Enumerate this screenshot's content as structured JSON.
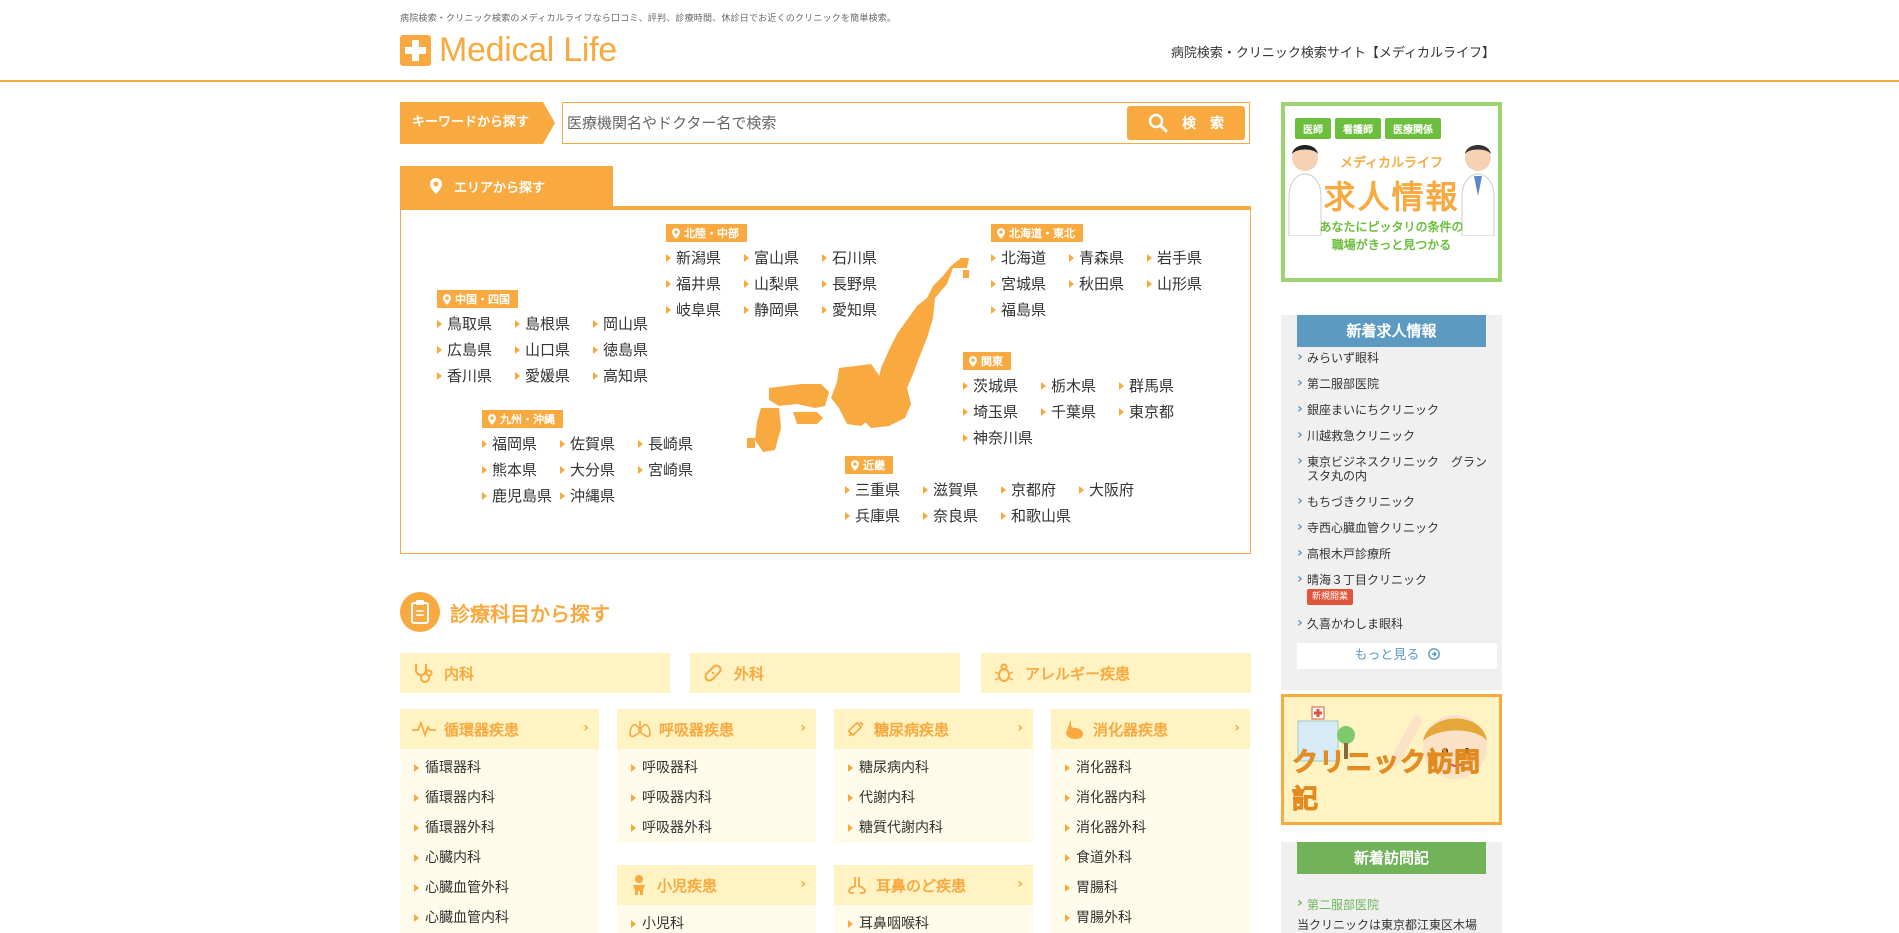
{
  "header": {
    "tagline": "病院検索・クリニック検索のメディカルライフなら口コミ、評判、診療時間、休診日でお近くのクリニックを簡単検索。",
    "logo_text": "Medical Life",
    "site_title": "病院検索・クリニック検索サイト【メディカルライフ】",
    "accent_color": "#f8a93f"
  },
  "search": {
    "label": "キーワードから探す",
    "placeholder": "医療機関名やドクター名で検索",
    "value": "",
    "button_label": "検　索"
  },
  "area": {
    "tab_label": "エリアから探す",
    "regions": {
      "hokuriku": {
        "label": "北陸・中部",
        "prefs": [
          "新潟県",
          "富山県",
          "石川県",
          "福井県",
          "山梨県",
          "長野県",
          "岐阜県",
          "静岡県",
          "愛知県"
        ]
      },
      "hokkaido": {
        "label": "北海道・東北",
        "prefs": [
          "北海道",
          "青森県",
          "岩手県",
          "宮城県",
          "秋田県",
          "山形県",
          "福島県"
        ]
      },
      "chugoku": {
        "label": "中国・四国",
        "prefs": [
          "鳥取県",
          "島根県",
          "岡山県",
          "広島県",
          "山口県",
          "徳島県",
          "香川県",
          "愛媛県",
          "高知県"
        ]
      },
      "kanto": {
        "label": "関東",
        "prefs": [
          "茨城県",
          "栃木県",
          "群馬県",
          "埼玉県",
          "千葉県",
          "東京都",
          "神奈川県"
        ]
      },
      "kyushu": {
        "label": "九州・沖縄",
        "prefs": [
          "福岡県",
          "佐賀県",
          "長崎県",
          "熊本県",
          "大分県",
          "宮崎県",
          "鹿児島県",
          "沖縄県"
        ]
      },
      "kinki": {
        "label": "近畿",
        "prefs": [
          "三重県",
          "滋賀県",
          "京都府",
          "大阪府",
          "兵庫県",
          "奈良県",
          "和歌山県"
        ]
      }
    }
  },
  "departments": {
    "title": "診療科目から探す",
    "big": [
      "内科",
      "外科",
      "アレルギー疾患"
    ],
    "columns": [
      {
        "head": "循環器疾患",
        "items": [
          "循環器科",
          "循環器内科",
          "循環器外科",
          "心臓内科",
          "心臓血管外科",
          "心臓血管内科"
        ]
      },
      {
        "head": "呼吸器疾患",
        "items": [
          "呼吸器科",
          "呼吸器内科",
          "呼吸器外科"
        ]
      },
      {
        "head": "糖尿病疾患",
        "items": [
          "糖尿病内科",
          "代謝内科",
          "糖質代謝内科"
        ]
      },
      {
        "head": "消化器疾患",
        "items": [
          "消化器科",
          "消化器内科",
          "消化器外科",
          "食道外科",
          "胃腸科",
          "胃腸外科"
        ]
      },
      {
        "head": "小児疾患",
        "items": [
          "小児科"
        ]
      },
      {
        "head": "耳鼻のど疾患",
        "items": [
          "耳鼻咽喉科"
        ]
      }
    ],
    "chevron": "›"
  },
  "sidebar": {
    "job_banner": {
      "tabs": [
        "医師",
        "看護師",
        "医療関係"
      ],
      "small": "メディカルライフ",
      "big": "求人情報",
      "sub_line1": "あなたにピッタリの条件の",
      "sub_line2": "職場がきっと見つかる"
    },
    "new_jobs": {
      "title": "新着求人情報",
      "items": [
        {
          "label": "みらいず眼科",
          "badge": ""
        },
        {
          "label": "第二服部医院",
          "badge": ""
        },
        {
          "label": "銀座まいにちクリニック",
          "badge": ""
        },
        {
          "label": "川越救急クリニック",
          "badge": ""
        },
        {
          "label": "東京ビジネスクリニック　グランスタ丸の内",
          "badge": ""
        },
        {
          "label": "もちづきクリニック",
          "badge": ""
        },
        {
          "label": "寺西心臓血管クリニック",
          "badge": ""
        },
        {
          "label": "高根木戸診療所",
          "badge": ""
        },
        {
          "label": "晴海３丁目クリニック",
          "badge": "新規開業"
        },
        {
          "label": "久喜かわしま眼科",
          "badge": ""
        }
      ],
      "more": "もっと見る"
    },
    "visit_banner": {
      "title": "クリニック訪問記"
    },
    "new_visits": {
      "title": "新着訪問記",
      "clinic": "第二服部医院",
      "desc": "当クリニックは東京都江東区木場"
    }
  }
}
